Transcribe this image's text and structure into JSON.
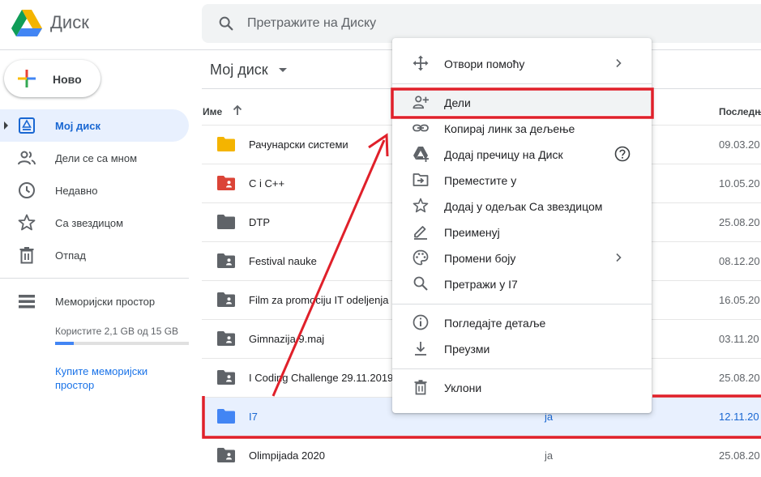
{
  "header": {
    "app_name": "Диск",
    "logo_icon": "google-drive-logo",
    "search_placeholder": "Претражите на Диску"
  },
  "sidebar": {
    "new_label": "Ново",
    "items": [
      {
        "label": "Мој диск",
        "icon": "my-drive-icon",
        "active": true
      },
      {
        "label": "Дели се са мном",
        "icon": "shared-people-icon"
      },
      {
        "label": "Недавно",
        "icon": "clock-icon"
      },
      {
        "label": "Са звездицом",
        "icon": "star-icon"
      },
      {
        "label": "Отпад",
        "icon": "trash-icon"
      }
    ],
    "storage": {
      "title": "Меморијски простор",
      "usage": "Користите 2,1 GB од 15 GB",
      "used_fraction": 0.14,
      "buy_link": "Купите меморијски простор"
    }
  },
  "main": {
    "title": "Мој диск",
    "columns": {
      "name": "Име",
      "modified": "Последњ"
    },
    "rows": [
      {
        "name": "Рачунарски системи",
        "owner": "",
        "modified": "09.03.20",
        "folder_color": "#f4b400"
      },
      {
        "name": "C i C++",
        "owner": "",
        "modified": "10.05.20",
        "folder_color": "#db4437",
        "shared": true
      },
      {
        "name": "DTP",
        "owner": "",
        "modified": "25.08.20",
        "folder_color": "#5f6368"
      },
      {
        "name": "Festival nauke",
        "owner": "",
        "modified": "08.12.20",
        "folder_color": "#5f6368",
        "shared": true
      },
      {
        "name": "Film za promociju IT odeljenja",
        "owner": "",
        "modified": "16.05.20",
        "folder_color": "#5f6368",
        "shared": true
      },
      {
        "name": "Gimnazija 9.maj",
        "owner": "",
        "modified": "03.11.20",
        "folder_color": "#5f6368",
        "shared": true
      },
      {
        "name": "I Coding Challenge 29.11.2019",
        "owner": "",
        "modified": "25.08.20",
        "folder_color": "#5f6368",
        "shared": true
      },
      {
        "name": "I7",
        "owner": "ja",
        "modified": "12.11.20",
        "folder_color": "#4285f4",
        "selected": true
      },
      {
        "name": "Olimpijada 2020",
        "owner": "ja",
        "modified": "25.08.20",
        "folder_color": "#5f6368",
        "shared": true
      }
    ]
  },
  "context_menu": {
    "items": [
      {
        "label": "Отвори помоћу",
        "icon": "open-with-icon",
        "submenu": true
      },
      {
        "label": "Дели",
        "icon": "person-add-icon",
        "highlighted": true
      },
      {
        "label": "Копирај линк за дељење",
        "icon": "link-icon"
      },
      {
        "label": "Додај пречицу на Диск",
        "icon": "add-shortcut-icon",
        "help": true
      },
      {
        "label": "Преместите у",
        "icon": "move-to-icon"
      },
      {
        "label": "Додај у одељак Са звездицом",
        "icon": "star-outline-icon"
      },
      {
        "label": "Преименуј",
        "icon": "rename-icon"
      },
      {
        "label": "Промени боју",
        "icon": "palette-icon",
        "submenu": true
      },
      {
        "label": "Претражи у I7",
        "icon": "search-icon"
      },
      {
        "label": "Погледајте детаље",
        "icon": "info-icon"
      },
      {
        "label": "Преузми",
        "icon": "download-icon"
      },
      {
        "label": "Уклони",
        "icon": "trash-icon"
      }
    ]
  },
  "annotation_color": "#e0202a",
  "accent_color": "#1967d2"
}
